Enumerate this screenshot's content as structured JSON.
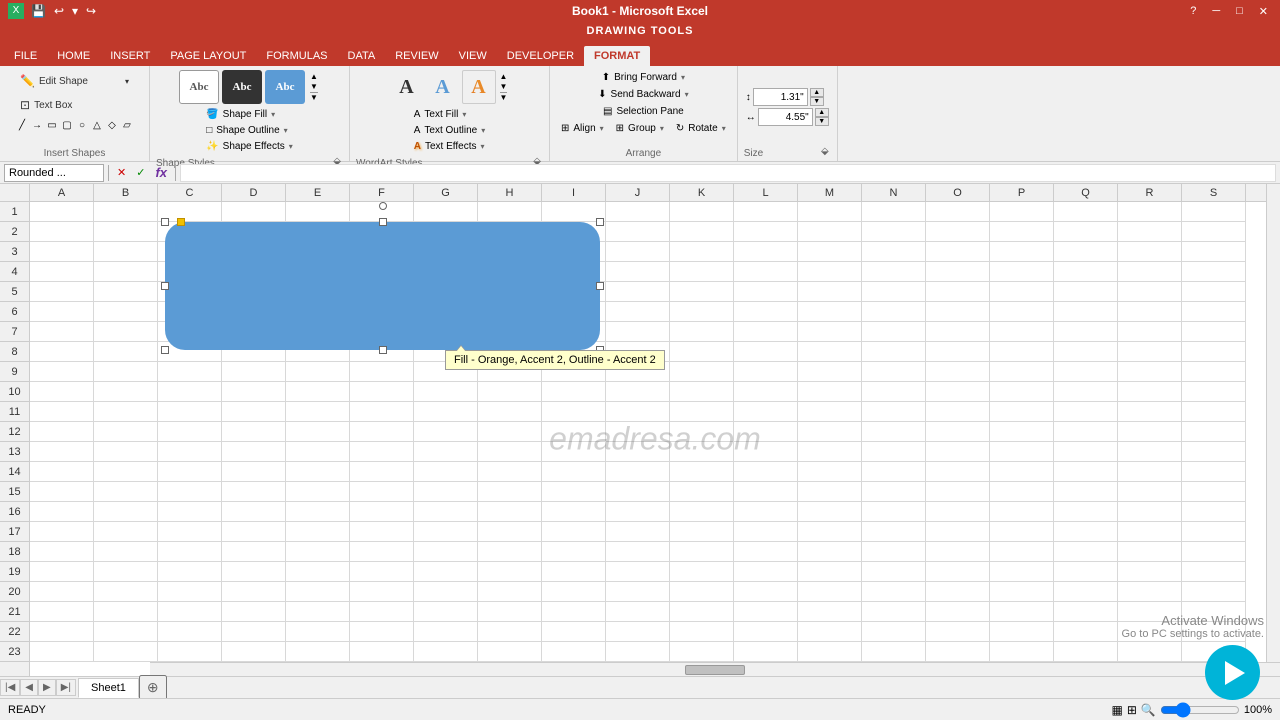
{
  "titlebar": {
    "title": "Book1 - Microsoft Excel",
    "drawing_tools": "DRAWING TOOLS",
    "close_btn": "✕",
    "min_btn": "─",
    "max_btn": "□",
    "help_btn": "?"
  },
  "ribbon_tabs": [
    {
      "id": "file",
      "label": "FILE"
    },
    {
      "id": "home",
      "label": "HOME"
    },
    {
      "id": "insert",
      "label": "INSERT"
    },
    {
      "id": "page_layout",
      "label": "PAGE LAYOUT"
    },
    {
      "id": "formulas",
      "label": "FORMULAS"
    },
    {
      "id": "data",
      "label": "DATA"
    },
    {
      "id": "review",
      "label": "REVIEW"
    },
    {
      "id": "view",
      "label": "VIEW"
    },
    {
      "id": "developer",
      "label": "DEVELOPER"
    },
    {
      "id": "format",
      "label": "FORMAT"
    }
  ],
  "ribbon": {
    "insert_shapes_label": "Insert Shapes",
    "shape_styles_label": "Shape Styles",
    "wordart_styles_label": "WordArt Styles",
    "arrange_label": "Arrange",
    "size_label": "Size",
    "edit_shape_btn": "Edit Shape",
    "text_box_btn": "Text Box",
    "shape_fill_btn": "Shape Fill",
    "shape_outline_btn": "Shape Outline",
    "shape_effects_btn": "Shape Effects",
    "text_fill_btn": "Text Fill",
    "text_outline_btn": "Text Outline",
    "text_effects_btn": "Text Effects",
    "bring_forward_btn": "Bring Forward",
    "send_backward_btn": "Send Backward",
    "selection_pane_btn": "Selection Pane",
    "align_btn": "Align",
    "group_btn": "Group",
    "rotate_btn": "Rotate",
    "width_value": "1.31\"",
    "height_value": "4.55\"",
    "shape_style_1_label": "Abc",
    "shape_style_2_label": "Abc",
    "shape_style_3_label": "Abc"
  },
  "formula_bar": {
    "name_box": "Rounded ...",
    "formula": ""
  },
  "tooltip": {
    "text": "Fill - Orange, Accent 2, Outline - Accent 2"
  },
  "columns": [
    "A",
    "B",
    "C",
    "D",
    "E",
    "F",
    "G",
    "H",
    "I",
    "J",
    "K",
    "L",
    "M",
    "N",
    "O",
    "P",
    "Q",
    "R",
    "S"
  ],
  "rows": [
    1,
    2,
    3,
    4,
    5,
    6,
    7,
    8,
    9,
    10,
    11,
    12,
    13,
    14,
    15,
    16,
    17,
    18,
    19,
    20,
    21,
    22,
    23
  ],
  "sheet_tabs": [
    {
      "label": "Sheet1",
      "active": true
    }
  ],
  "status": {
    "ready": "READY",
    "zoom": "100%"
  },
  "watermark": "emadresa.com",
  "activate_windows": {
    "line1": "Activate Windows",
    "line2": "Go to PC settings to activate."
  }
}
